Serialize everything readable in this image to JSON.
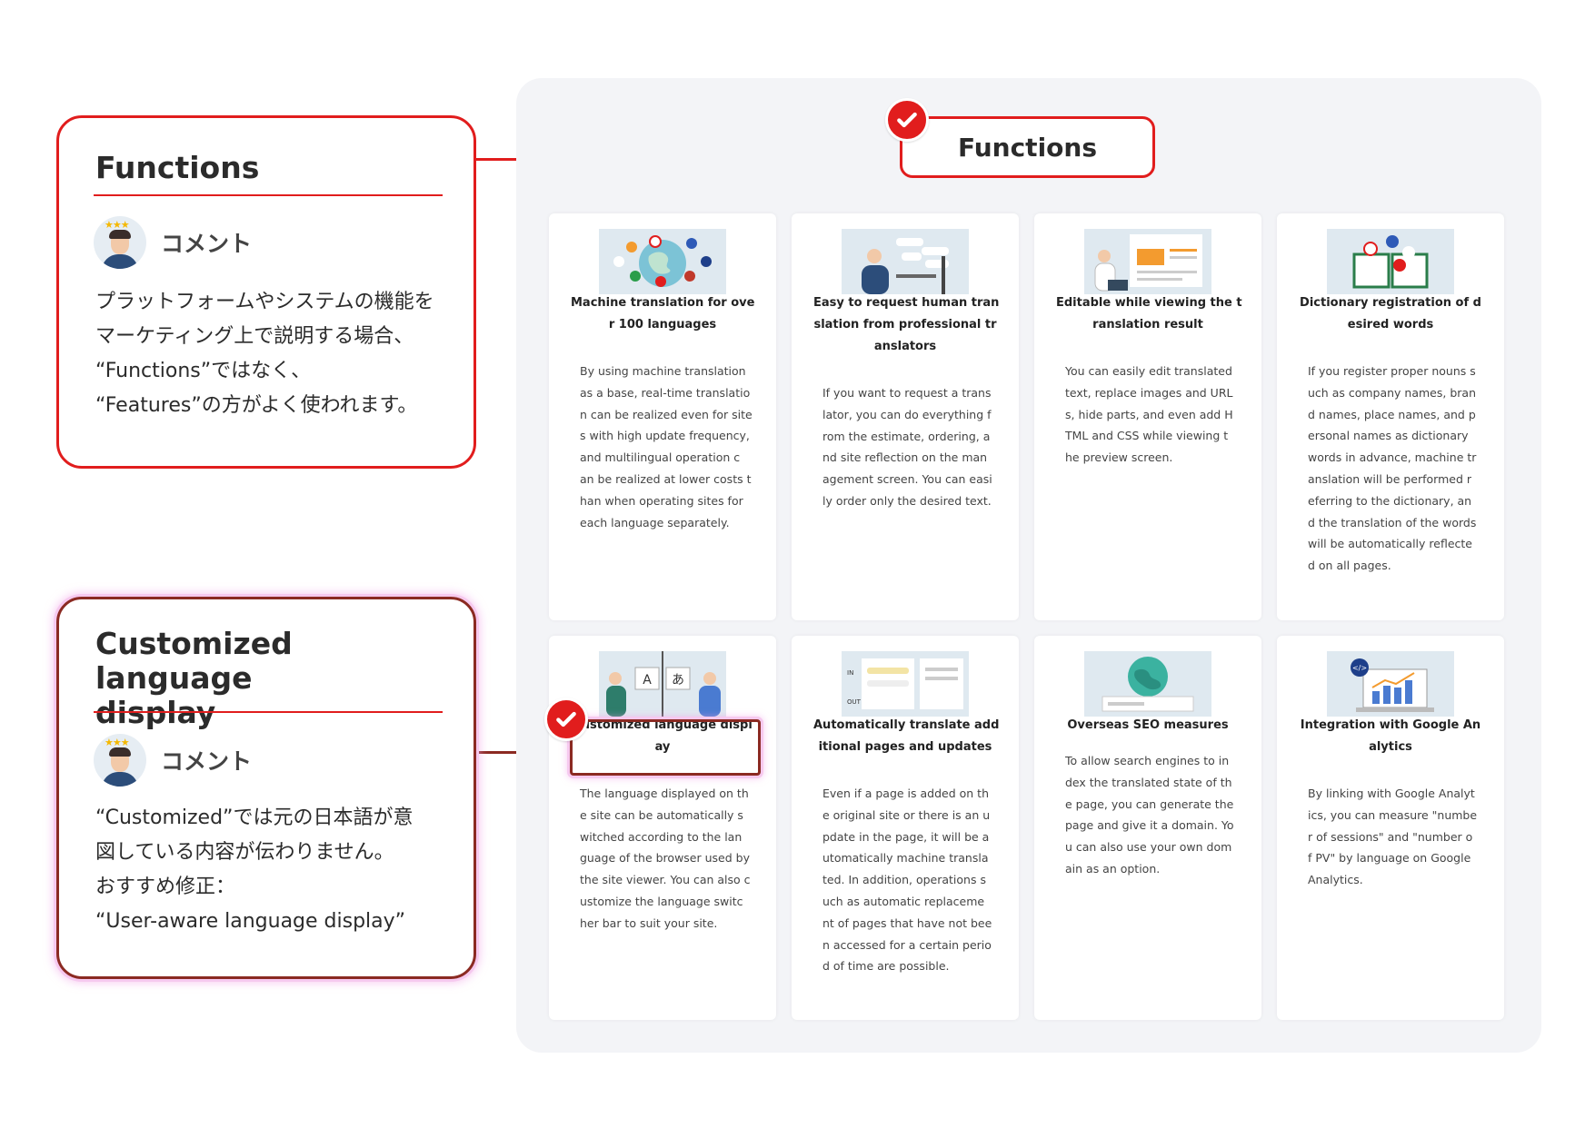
{
  "annotations": [
    {
      "title_lines": [
        "Functions"
      ],
      "comment_label": "コメント",
      "body_lines": [
        "プラットフォームやシステムの機能を",
        "マーケティング上で説明する場合、",
        "“Functions”ではなく、",
        "“Features”の方がよく使われます。"
      ]
    },
    {
      "title_lines": [
        "Customized language",
        "display"
      ],
      "comment_label": "コメント",
      "body_lines": [
        "“Customized”では元の日本語が意",
        "図している内容が伝わりません。",
        "おすすめ修正：",
        "“User-aware language display”"
      ]
    }
  ],
  "panel": {
    "heading": "Functions",
    "cards": [
      {
        "icon": "globe-flags-illustration",
        "title_lines": [
          "Machine translation for ove",
          "r 100 languages"
        ],
        "text_lines": [
          "By using machine translation",
          "as a base, real-time translatio",
          "n can be realized even for site",
          "s with high update frequency,",
          "and multilingual operation c",
          "an be realized at lower costs t",
          "han when operating sites for",
          "each language separately."
        ]
      },
      {
        "icon": "human-translator-illustration",
        "title_lines": [
          "Easy to request human tran",
          "slation from professional tr",
          "anslators"
        ],
        "text_lines": [
          "If you want to request a trans",
          "lator, you can do everything f",
          "rom the estimate, ordering, a",
          "nd site reflection on the man",
          "agement screen. You can easi",
          "ly order only the desired text."
        ]
      },
      {
        "icon": "editor-preview-illustration",
        "title_lines": [
          "Editable while viewing the t",
          "ranslation result"
        ],
        "text_lines": [
          "You can easily edit translated",
          "text, replace images and URL",
          "s, hide parts, and even add H",
          "TML and CSS while viewing t",
          "he preview screen."
        ]
      },
      {
        "icon": "dictionary-book-illustration",
        "title_lines": [
          "Dictionary registration of d",
          "esired words"
        ],
        "text_lines": [
          "If you register proper nouns s",
          "uch as company names, bran",
          "d names, place names, and p",
          "ersonal names as dictionary",
          "words in advance, machine tr",
          "anslation will be performed r",
          "eferring to the dictionary, an",
          "d the translation of the words",
          "will be automatically reflecte",
          "d on all pages."
        ]
      },
      {
        "icon": "language-switch-illustration",
        "illus_labels": [
          "A",
          "あ"
        ],
        "title_lines": [
          "Customized language displ",
          "ay"
        ],
        "text_lines": [
          "The language displayed on th",
          "e site can be automatically s",
          "witched according to the lan",
          "guage of the browser used by",
          "the site viewer. You can also c",
          "ustomize the language switc",
          "her bar to suit your site."
        ]
      },
      {
        "icon": "auto-update-illustration",
        "illus_labels": [
          "IN",
          "OUT"
        ],
        "title_lines": [
          "Automatically translate add",
          "itional pages and updates"
        ],
        "text_lines": [
          "Even if a page is added on th",
          "e original site or there is an u",
          "pdate in the page, it will be a",
          "utomatically machine transla",
          "ted. In addition, operations s",
          "uch as automatic replaceme",
          "nt of pages that have not bee",
          "n accessed for a certain perio",
          "d of time are possible."
        ]
      },
      {
        "icon": "seo-globe-illustration",
        "title_lines": [
          "Overseas SEO measures"
        ],
        "text_lines": [
          "To allow search engines to in",
          "dex the translated state of th",
          "e page, you can generate the",
          "page and give it a domain. Yo",
          "u can also use your own dom",
          "ain as an option."
        ]
      },
      {
        "icon": "analytics-laptop-illustration",
        "illus_labels": [
          "</>"
        ],
        "title_lines": [
          "Integration with Google An",
          "alytics"
        ],
        "text_lines": [
          "By linking with Google Analyt",
          "ics, you can measure \"numbe",
          "r of sessions\" and \"number o",
          "f PV\" by language on Google",
          "Analytics."
        ]
      }
    ]
  },
  "colors": {
    "accent_red": "#e11d1d",
    "highlight_brown": "#8b2a22",
    "highlight_glow": "#f6c9ef",
    "panel_bg": "#f3f4f7"
  }
}
